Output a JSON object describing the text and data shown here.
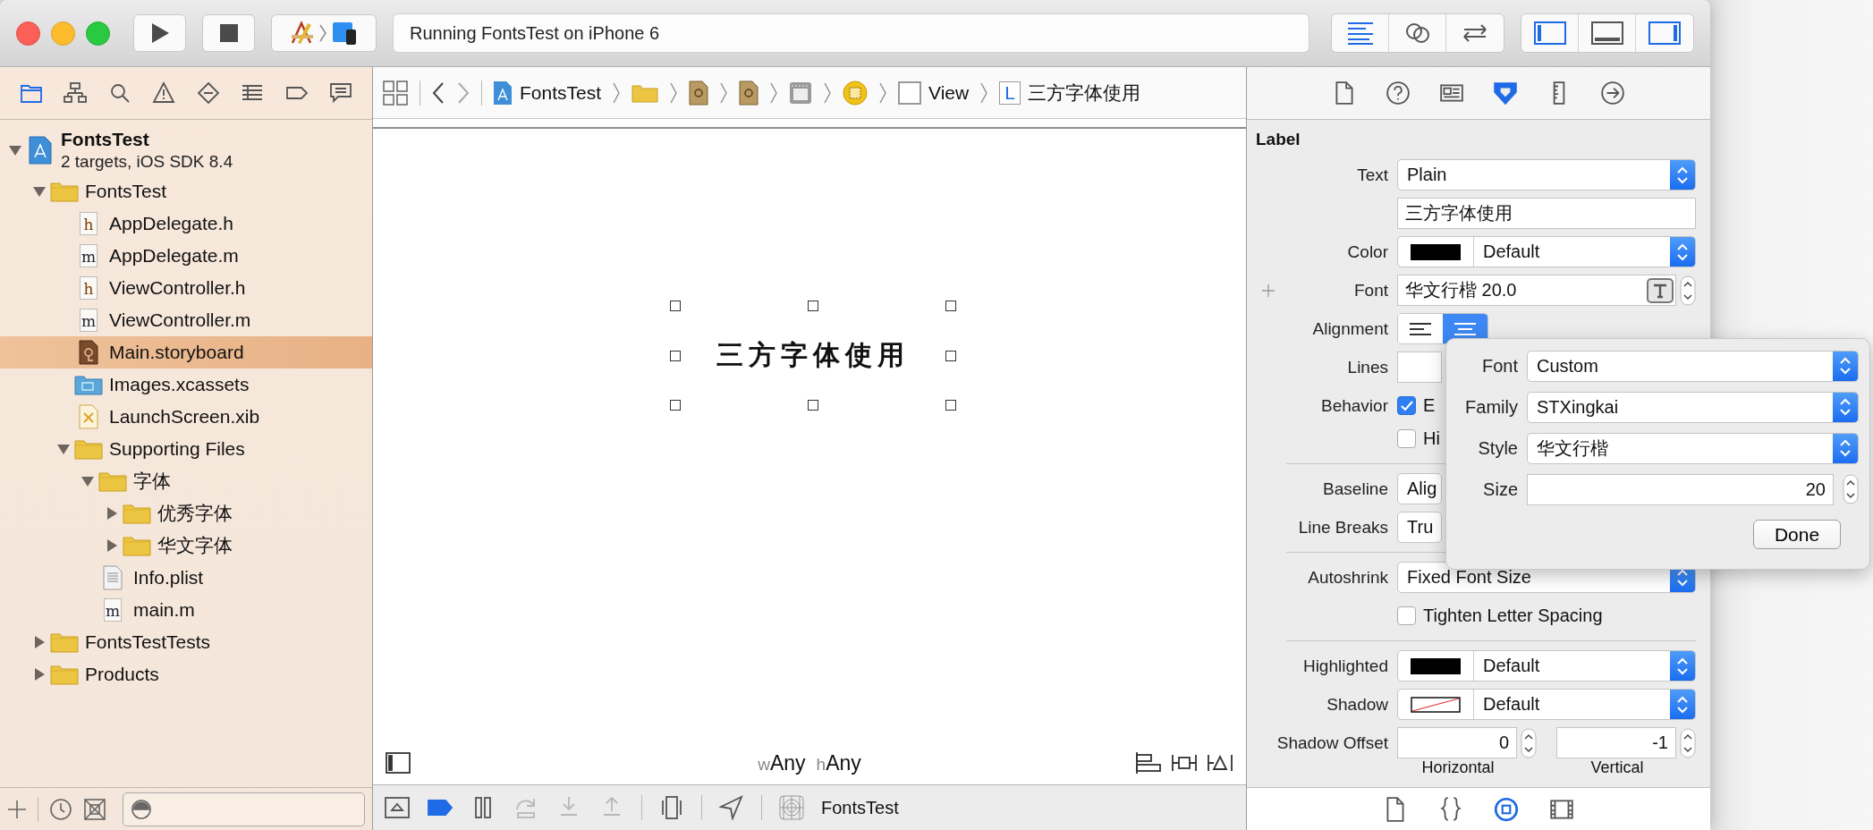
{
  "toolbar": {
    "status": "Running FontsTest on iPhone 6",
    "editor_modes": [
      {
        "kind": "standard",
        "selected": true
      },
      {
        "kind": "assistant",
        "selected": false
      },
      {
        "kind": "version",
        "selected": false
      }
    ],
    "panels": [
      {
        "kind": "navigator",
        "on": true
      },
      {
        "kind": "debug",
        "on": false
      },
      {
        "kind": "utilities",
        "on": true
      }
    ]
  },
  "navigator": {
    "tabs": [
      {
        "kind": "project",
        "selected": true
      },
      {
        "kind": "symbols",
        "selected": false
      },
      {
        "kind": "find",
        "selected": false
      },
      {
        "kind": "issues",
        "selected": false
      },
      {
        "kind": "tests",
        "selected": false
      },
      {
        "kind": "debug",
        "selected": false
      },
      {
        "kind": "breakpoints",
        "selected": false
      },
      {
        "kind": "reports",
        "selected": false
      }
    ],
    "tree": [
      {
        "name": "FontsTest",
        "subtitle": "2 targets, iOS SDK 8.4",
        "kind": "project",
        "expanded": true,
        "selected": false,
        "children": [
          {
            "name": "FontsTest",
            "kind": "folder",
            "expanded": true,
            "selected": false,
            "children": [
              {
                "name": "AppDelegate.h",
                "kind": "header",
                "icon_letter": "h",
                "selected": false
              },
              {
                "name": "AppDelegate.m",
                "kind": "source",
                "icon_letter": "m",
                "selected": false
              },
              {
                "name": "ViewController.h",
                "kind": "header",
                "icon_letter": "h",
                "selected": false
              },
              {
                "name": "ViewController.m",
                "kind": "source",
                "icon_letter": "m",
                "selected": false
              },
              {
                "name": "Main.storyboard",
                "kind": "storyboard",
                "selected": true
              },
              {
                "name": "Images.xcassets",
                "kind": "assets",
                "selected": false
              },
              {
                "name": "LaunchScreen.xib",
                "kind": "xib",
                "selected": false
              },
              {
                "name": "Supporting Files",
                "kind": "folder",
                "expanded": true,
                "selected": false,
                "children": [
                  {
                    "name": "字体",
                    "kind": "folder",
                    "expanded": true,
                    "selected": false,
                    "children": [
                      {
                        "name": "优秀字体",
                        "kind": "folder",
                        "expanded": false,
                        "selected": false
                      },
                      {
                        "name": "华文字体",
                        "kind": "folder",
                        "expanded": false,
                        "selected": false
                      }
                    ]
                  },
                  {
                    "name": "Info.plist",
                    "kind": "plist",
                    "selected": false
                  },
                  {
                    "name": "main.m",
                    "kind": "source",
                    "icon_letter": "m",
                    "selected": false
                  }
                ]
              }
            ]
          },
          {
            "name": "FontsTestTests",
            "kind": "folder",
            "expanded": false,
            "selected": false
          },
          {
            "name": "Products",
            "kind": "folder",
            "expanded": false,
            "selected": false
          }
        ]
      }
    ]
  },
  "jump_bar": [
    {
      "kind": "project",
      "label": "FontsTest"
    },
    {
      "kind": "folder"
    },
    {
      "kind": "storyboard"
    },
    {
      "kind": "storyboard"
    },
    {
      "kind": "scene"
    },
    {
      "kind": "controller"
    },
    {
      "kind": "view",
      "label": "View"
    },
    {
      "kind": "label",
      "icon_letter": "L",
      "label": "三方字体使用"
    }
  ],
  "canvas": {
    "label_text": "三方字体使用",
    "w_prefix": "w",
    "w_value": "Any",
    "h_prefix": "h",
    "h_value": "Any"
  },
  "debug_bar": {
    "buttons": [
      {
        "kind": "console",
        "on": false,
        "disabled": false
      },
      {
        "kind": "breakpoints",
        "on": true,
        "disabled": false
      },
      {
        "kind": "pause",
        "on": false,
        "disabled": false
      },
      {
        "kind": "step-over",
        "on": false,
        "disabled": true
      },
      {
        "kind": "step-into",
        "on": false,
        "disabled": true
      },
      {
        "kind": "step-out",
        "on": false,
        "disabled": true
      },
      {
        "kind": "view-debug",
        "on": false,
        "disabled": false
      },
      {
        "kind": "location",
        "on": false,
        "disabled": false
      }
    ],
    "target": "FontsTest"
  },
  "inspector": {
    "tabs": [
      {
        "kind": "file",
        "selected": false
      },
      {
        "kind": "help",
        "selected": false
      },
      {
        "kind": "identity",
        "selected": false
      },
      {
        "kind": "attributes",
        "selected": true
      },
      {
        "kind": "size",
        "selected": false
      },
      {
        "kind": "connections",
        "selected": false
      }
    ],
    "section": "Label",
    "text": {
      "label": "Text",
      "value": "Plain"
    },
    "text_value": "三方字体使用",
    "color": {
      "label": "Color",
      "color": "#000000",
      "cleared": false,
      "value": "Default"
    },
    "font": {
      "label": "Font",
      "value": "华文行楷 20.0"
    },
    "alignment": {
      "label": "Alignment",
      "options": [
        {
          "kind": "left",
          "selected": false
        },
        {
          "kind": "center",
          "selected": true
        }
      ]
    },
    "lines": {
      "label": "Lines"
    },
    "behavior": {
      "label": "Behavior",
      "options": [
        {
          "label": "E",
          "checked": true
        },
        {
          "label": "Hi",
          "checked": false
        }
      ]
    },
    "baseline": {
      "label": "Baseline",
      "value": "Alig"
    },
    "line_breaks": {
      "label": "Line Breaks",
      "value": "Tru"
    },
    "autoshrink": {
      "label": "Autoshrink",
      "value": "Fixed Font Size"
    },
    "tighten": {
      "label": "Tighten Letter Spacing",
      "checked": false
    },
    "highlighted": {
      "label": "Highlighted",
      "color": "#000000",
      "cleared": false,
      "value": "Default"
    },
    "shadow": {
      "label": "Shadow",
      "cleared": true,
      "value": "Default"
    },
    "shadow_offset": {
      "label": "Shadow Offset",
      "horizontal": "0",
      "vertical": "-1",
      "horizontal_label": "Horizontal",
      "vertical_label": "Vertical"
    },
    "library_tabs": [
      {
        "kind": "file",
        "selected": false
      },
      {
        "kind": "code",
        "selected": false
      },
      {
        "kind": "object",
        "selected": true
      },
      {
        "kind": "media",
        "selected": false
      }
    ]
  },
  "popover": {
    "font": {
      "label": "Font",
      "value": "Custom"
    },
    "family": {
      "label": "Family",
      "value": "STXingkai"
    },
    "style": {
      "label": "Style",
      "value": "华文行楷"
    },
    "size": {
      "label": "Size",
      "value": "20"
    },
    "done": "Done"
  }
}
